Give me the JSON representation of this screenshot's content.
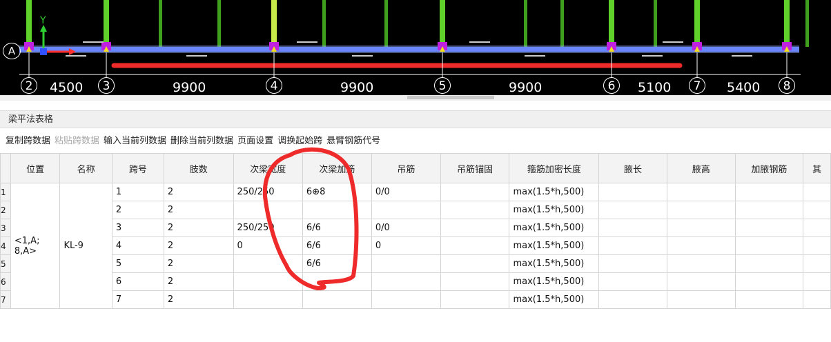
{
  "cad": {
    "row_axis": "A",
    "axes": [
      "2",
      "3",
      "4",
      "5",
      "6",
      "7",
      "8"
    ],
    "dimensions": [
      "4500",
      "9900",
      "9900",
      "9900",
      "5100",
      "5400"
    ]
  },
  "panel": {
    "title": "梁平法表格",
    "toolbar": [
      {
        "label": "复制跨数据",
        "enabled": true
      },
      {
        "label": "粘贴跨数据",
        "enabled": false
      },
      {
        "label": "输入当前列数据",
        "enabled": true
      },
      {
        "label": "删除当前列数据",
        "enabled": true
      },
      {
        "label": "页面设置",
        "enabled": true
      },
      {
        "label": "调换起始跨",
        "enabled": true
      },
      {
        "label": "悬臂钢筋代号",
        "enabled": true
      }
    ]
  },
  "table": {
    "columns": [
      "",
      "位置",
      "名称",
      "跨号",
      "肢数",
      "次梁宽度",
      "次梁加筋",
      "吊筋",
      "吊筋锚固",
      "箍筋加密长度",
      "腋长",
      "腋高",
      "加腋钢筋",
      "其"
    ],
    "position": "<1,A;\n8,A>",
    "name": "KL-9",
    "rows": [
      {
        "num": "1",
        "span": "1",
        "legs": "2",
        "sec_width": "250/250",
        "sec_rebar": "6⊕8",
        "hanger": "0/0",
        "hanger_anchor": "",
        "dense_len": "max(1.5*h,500)",
        "haunch_len": "",
        "haunch_h": "",
        "haunch_rebar": ""
      },
      {
        "num": "2",
        "span": "2",
        "legs": "2",
        "sec_width": "",
        "sec_rebar": "",
        "hanger": "",
        "hanger_anchor": "",
        "dense_len": "max(1.5*h,500)",
        "haunch_len": "",
        "haunch_h": "",
        "haunch_rebar": ""
      },
      {
        "num": "3",
        "span": "3",
        "legs": "2",
        "sec_width": "250/250",
        "sec_rebar": "6/6",
        "hanger": "0/0",
        "hanger_anchor": "",
        "dense_len": "max(1.5*h,500)",
        "haunch_len": "",
        "haunch_h": "",
        "haunch_rebar": ""
      },
      {
        "num": "4",
        "span": "4",
        "legs": "2",
        "sec_width": "0",
        "sec_rebar": "6/6",
        "hanger": "0",
        "hanger_anchor": "",
        "dense_len": "max(1.5*h,500)",
        "haunch_len": "",
        "haunch_h": "",
        "haunch_rebar": ""
      },
      {
        "num": "5",
        "span": "5",
        "legs": "2",
        "sec_width": "",
        "sec_rebar": "6/6",
        "hanger": "",
        "hanger_anchor": "",
        "dense_len": "max(1.5*h,500)",
        "haunch_len": "",
        "haunch_h": "",
        "haunch_rebar": ""
      },
      {
        "num": "6",
        "span": "6",
        "legs": "2",
        "sec_width": "",
        "sec_rebar": "",
        "hanger": "",
        "hanger_anchor": "",
        "dense_len": "max(1.5*h,500)",
        "haunch_len": "",
        "haunch_h": "",
        "haunch_rebar": ""
      },
      {
        "num": "7",
        "span": "7",
        "legs": "2",
        "sec_width": "",
        "sec_rebar": "",
        "hanger": "",
        "hanger_anchor": "",
        "dense_len": "max(1.5*h,500)",
        "haunch_len": "",
        "haunch_h": "",
        "haunch_rebar": ""
      }
    ]
  },
  "colors": {
    "column_green": "#5fd12a",
    "beam_blue": "#6a86ff",
    "support_magenta": "#c020e0",
    "markup_red": "#ee2a2a"
  }
}
